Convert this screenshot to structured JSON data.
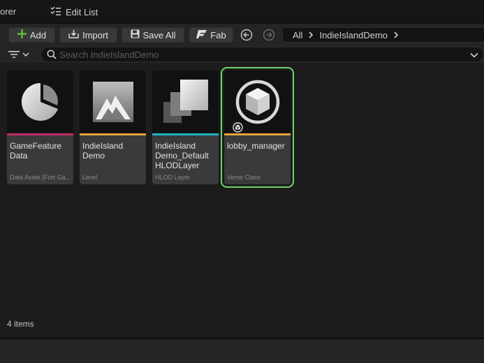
{
  "tabbar": {
    "partial_tab_label": "orer",
    "edit_list_label": "Edit List"
  },
  "toolbar": {
    "add_label": "Add",
    "import_label": "Import",
    "save_all_label": "Save All",
    "fab_label": "Fab",
    "breadcrumb": [
      "All",
      "IndieIslandDemo"
    ]
  },
  "search": {
    "placeholder": "Search IndieIslandDemo"
  },
  "assets": [
    {
      "name": "GameFeature Data",
      "type": "Data Asset (Fort Ga...",
      "strip_color": "#c22d6b",
      "icon": "pie-chart-icon"
    },
    {
      "name": "IndieIsland Demo",
      "type": "Level",
      "strip_color": "#e8a23c",
      "icon": "level-icon"
    },
    {
      "name": "IndieIsland Demo_Default HLODLayer",
      "type": "HLOD Layer",
      "strip_color": "#1eb2c6",
      "icon": "layers-icon"
    },
    {
      "name": "lobby_manager",
      "type": "Verse Class",
      "strip_color": "#e8a23c",
      "icon": "cube-icon",
      "selected": true
    }
  ],
  "status": {
    "item_count": "4 items"
  },
  "colors": {
    "add_plus": "#5fbf3a",
    "selection_outline": "#6fd36b"
  }
}
